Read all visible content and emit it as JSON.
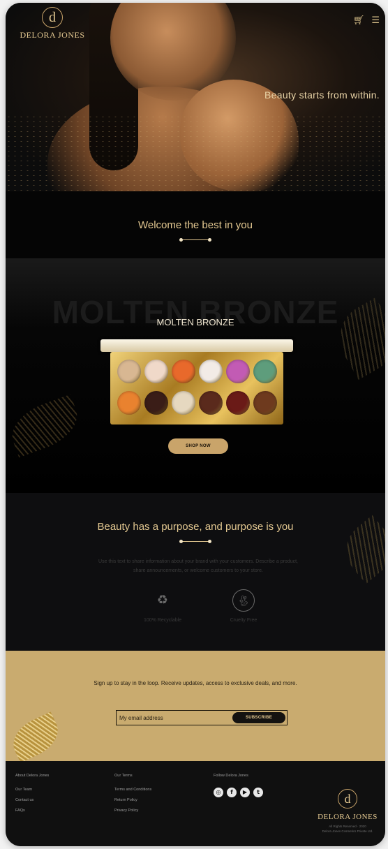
{
  "header": {
    "logo_letter": "d",
    "brand_name": "DELORA JONES",
    "cart_icon": "cart-icon",
    "menu_icon": "menu-icon",
    "tagline": "Beauty starts from within."
  },
  "welcome": {
    "title": "Welcome the best in you"
  },
  "product": {
    "background_text": "MOLTEN BRONZE",
    "title": "MOLTEN BRONZE",
    "button_label": "SHOP NOW",
    "shade_colors": [
      "#d8b792",
      "#f0d9c9",
      "#e8692b",
      "#f2ebe6",
      "#c25bb4",
      "#5e9d7c",
      "#e9822f",
      "#3a1d17",
      "#e6d8c0",
      "#5a2a1c",
      "#6a1a17",
      "#6e3a1e"
    ]
  },
  "purpose": {
    "title": "Beauty has a purpose, and purpose is you",
    "description": "Use this text to share information about your brand with your customers. Describe a product, share announcements, or welcome customers to your store.",
    "features": [
      {
        "icon": "recycle-icon",
        "label": "100% Recyclable"
      },
      {
        "icon": "rabbit-icon",
        "label": "Cruelty Free"
      }
    ]
  },
  "newsletter": {
    "text": "Sign up to stay in the loop. Receive updates, access to exclusive deals, and more.",
    "input_placeholder": "My email address",
    "button_label": "SUBSCRIBE"
  },
  "footer": {
    "about": {
      "heading": "About Delora Jones",
      "links": [
        "Our Team",
        "Contact us",
        "FAQs"
      ]
    },
    "terms": {
      "heading": "Our Terms",
      "links": [
        "Terms and Conditions",
        "Return Policy",
        "Privacy Policy"
      ]
    },
    "follow": {
      "heading": "Follow Delora Jones",
      "icons": [
        "instagram-icon",
        "facebook-icon",
        "youtube-icon",
        "twitter-icon"
      ]
    },
    "logo_letter": "d",
    "brand_name": "DELORA JONES",
    "copyright_line1": "All Rights Reserved · 2020",
    "copyright_line2": "Delora Jones Cosmetics Private Ltd."
  },
  "colors": {
    "gold": "#c9a46a",
    "light_gold": "#e3c891",
    "background": "#0a0a0a",
    "newsletter_bg": "#c9ab6f"
  }
}
